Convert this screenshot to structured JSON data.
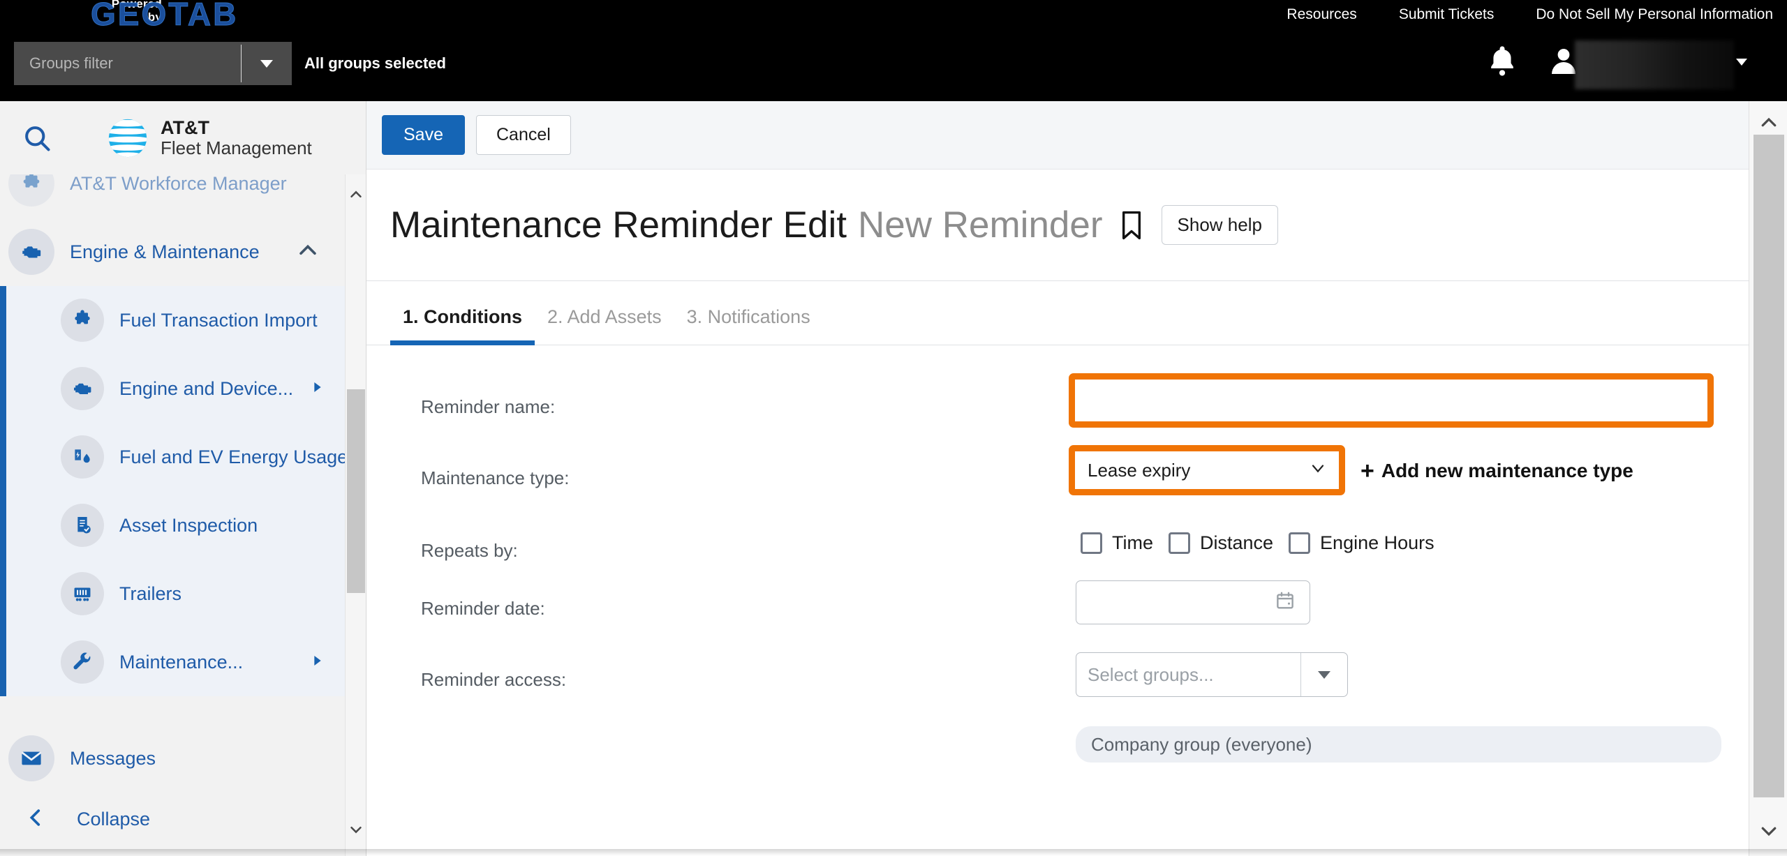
{
  "topbar": {
    "powered_line1": "Powered",
    "powered_line2": "by",
    "brand": "GEOTAB",
    "links": [
      {
        "label": "Resources"
      },
      {
        "label": "Submit Tickets"
      },
      {
        "label": "Do Not Sell My Personal Information"
      }
    ],
    "groups_filter_placeholder": "Groups filter",
    "groups_status": "All groups selected",
    "bell_icon": "notification-bell-icon",
    "user_icon": "user-avatar-icon",
    "user_name_redacted": ""
  },
  "sidebar": {
    "search_icon": "search-icon",
    "brand_line1": "AT&T",
    "brand_line2": "Fleet Management",
    "items": [
      {
        "label": "AT&T Workforce Manager",
        "icon": "puzzle-icon",
        "type": "top",
        "state": "partial"
      },
      {
        "label": "Engine & Maintenance",
        "icon": "engine-icon",
        "type": "top",
        "state": "expanded"
      },
      {
        "label": "Fuel Transaction Import",
        "icon": "puzzle-icon",
        "type": "sub"
      },
      {
        "label": "Engine and Device...",
        "icon": "engine-icon",
        "type": "sub",
        "submenu": true
      },
      {
        "label": "Fuel and EV Energy Usage",
        "icon": "fuel-ev-icon",
        "type": "sub"
      },
      {
        "label": "Asset Inspection",
        "icon": "clipboard-check-icon",
        "type": "sub"
      },
      {
        "label": "Trailers",
        "icon": "trailer-icon",
        "type": "sub"
      },
      {
        "label": "Maintenance...",
        "icon": "wrench-icon",
        "type": "sub",
        "submenu": true
      }
    ],
    "messages_label": "Messages",
    "messages_icon": "envelope-icon",
    "collapse_label": "Collapse",
    "collapse_icon": "chevron-left-icon"
  },
  "toolbar": {
    "save_label": "Save",
    "cancel_label": "Cancel"
  },
  "page": {
    "title": "Maintenance Reminder Edit",
    "subtitle": "New Reminder",
    "bookmark_icon": "bookmark-icon",
    "help_label": "Show help"
  },
  "tabs": [
    {
      "label": "1. Conditions",
      "active": true
    },
    {
      "label": "2. Add Assets",
      "active": false
    },
    {
      "label": "3. Notifications",
      "active": false
    }
  ],
  "form": {
    "reminder_name": {
      "label": "Reminder name:",
      "value": "",
      "placeholder": "",
      "highlighted": true
    },
    "maintenance_type": {
      "label": "Maintenance type:",
      "value": "Lease expiry",
      "highlighted": true,
      "add_link": "Add new maintenance type",
      "add_icon": "plus-icon"
    },
    "repeats_by": {
      "label": "Repeats by:",
      "options": [
        {
          "label": "Time",
          "checked": false
        },
        {
          "label": "Distance",
          "checked": false
        },
        {
          "label": "Engine Hours",
          "checked": false
        }
      ]
    },
    "reminder_date": {
      "label": "Reminder date:",
      "value": "",
      "icon": "calendar-icon"
    },
    "reminder_access": {
      "label": "Reminder access:",
      "placeholder": "Select groups...",
      "value": "",
      "chip": "Company group (everyone)"
    }
  },
  "colors": {
    "highlight": "#F07406",
    "accent_blue": "#1565b5",
    "brand_blue": "#1f5ba8",
    "topbar_bg": "#000000"
  }
}
